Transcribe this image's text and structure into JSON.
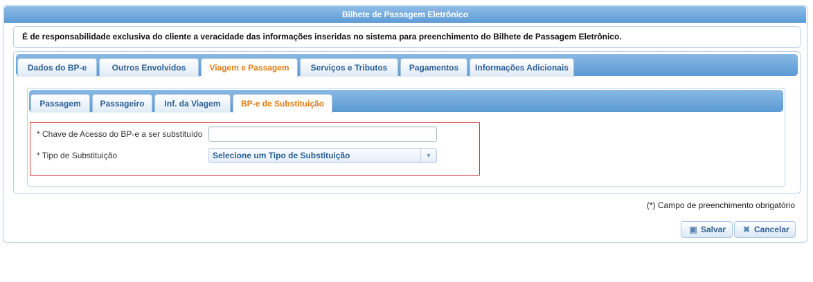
{
  "panel": {
    "title": "Bilhete de Passagem Eletrônico"
  },
  "notice": "É de responsabilidade exclusiva do cliente a veracidade das informações inseridas no sistema para preenchimento do Bilhete de Passagem Eletrônico.",
  "tabs": [
    {
      "label": "Dados do BP-e",
      "active": false
    },
    {
      "label": "Outros Envolvidos",
      "active": false
    },
    {
      "label": "Viagem e Passagem",
      "active": true
    },
    {
      "label": "Serviços e Tributos",
      "active": false
    },
    {
      "label": "Pagamentos",
      "active": false
    },
    {
      "label": "Informações Adicionais",
      "active": false
    }
  ],
  "subtabs": [
    {
      "label": "Passagem",
      "active": false
    },
    {
      "label": "Passageiro",
      "active": false
    },
    {
      "label": "Inf. da Viagem",
      "active": false
    },
    {
      "label": "BP-e de Substituição",
      "active": true
    }
  ],
  "form": {
    "chave_label": "* Chave de Acesso do BP-e a ser substituído",
    "chave_value": "",
    "tipo_label": "* Tipo de Substituição",
    "tipo_selected": "Selecione um Tipo de Substituição"
  },
  "required_note": "(*) Campo de preenchimento obrigatório",
  "buttons": {
    "save": "Salvar",
    "cancel": "Cancelar"
  },
  "icons": {
    "save": "floppy-disk-icon",
    "cancel": "x-icon",
    "dropdown": "chevron-down-icon"
  },
  "colors": {
    "header": "#5d9bd6",
    "active_tab": "#e07b12",
    "tab_text": "#2c5f94",
    "highlight_border": "#d23a3a"
  }
}
